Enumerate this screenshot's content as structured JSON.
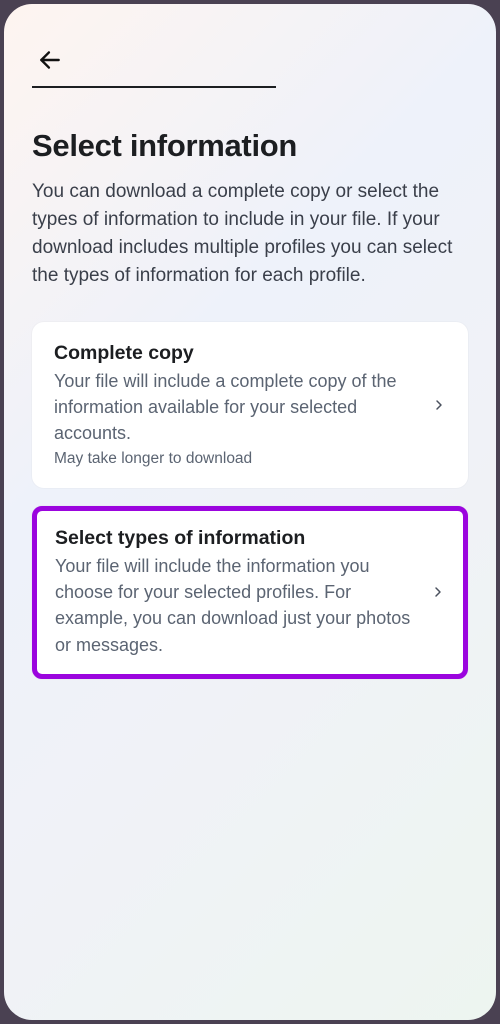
{
  "page": {
    "title": "Select information",
    "description": "You can download a complete copy or select the types of information to include in your file. If your download includes multiple profiles you can select the types of information for each profile."
  },
  "options": {
    "complete": {
      "title": "Complete copy",
      "desc": "Your file will include a complete copy of the information available for your selected accounts.",
      "note": "May take longer to download"
    },
    "selectTypes": {
      "title": "Select types of information",
      "desc": "Your file will include the information you choose for your selected profiles. For example, you can download just your photos or messages."
    }
  }
}
